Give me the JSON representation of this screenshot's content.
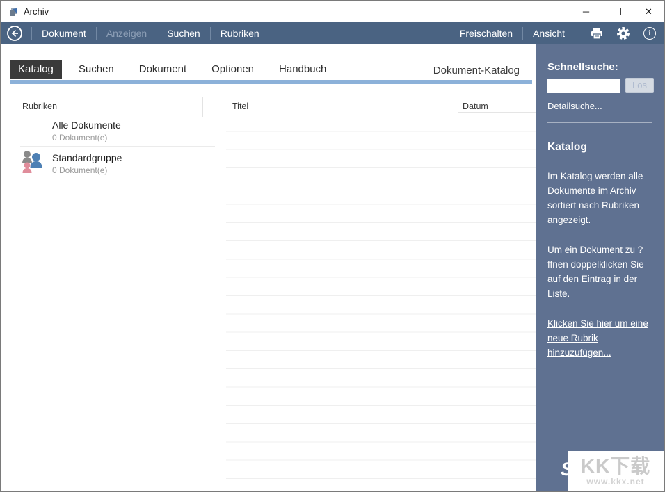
{
  "window": {
    "title": "Archiv",
    "controls": {
      "minimize": "─",
      "maximize": "☐",
      "close": "✕"
    }
  },
  "colors": {
    "toolbar": "#4a6382",
    "sidebar": "#5f7191",
    "accent_bar": "#8cb1d9",
    "active_tab": "#3a3a3a"
  },
  "toolbar": {
    "menu": [
      {
        "label": "Dokument",
        "enabled": true
      },
      {
        "label": "Anzeigen",
        "enabled": false
      },
      {
        "label": "Suchen",
        "enabled": true
      },
      {
        "label": "Rubriken",
        "enabled": true
      }
    ],
    "right": [
      {
        "label": "Freischalten"
      },
      {
        "label": "Ansicht"
      }
    ],
    "icons": [
      "back-icon",
      "printer-icon",
      "gear-icon",
      "info-icon"
    ]
  },
  "tabs": {
    "items": [
      {
        "label": "Katalog",
        "active": true
      },
      {
        "label": "Suchen",
        "active": false
      },
      {
        "label": "Dokument",
        "active": false
      },
      {
        "label": "Optionen",
        "active": false
      },
      {
        "label": "Handbuch",
        "active": false
      }
    ],
    "page_title": "Dokument-Katalog"
  },
  "catalog": {
    "header": "Rubriken",
    "items": [
      {
        "title": "Alle Dokumente",
        "count": "0 Dokument(e)",
        "icon": null
      },
      {
        "title": "Standardgruppe",
        "count": "0 Dokument(e)",
        "icon": "group-icon"
      }
    ]
  },
  "table": {
    "columns": [
      {
        "label": "Titel"
      },
      {
        "label": "Datum"
      }
    ],
    "rows": []
  },
  "sidebar": {
    "quick_search": {
      "label": "Schnellsuche:",
      "input_value": "",
      "button_label": "Los",
      "detail_link": "Detailsuche..."
    },
    "section": {
      "title": "Katalog",
      "p1": "Im Katalog werden alle Dokumente im Archiv sortiert nach Rubriken angezeigt.",
      "p2": "Um ein Dokument zu ?ffnen doppelklicken Sie auf den Eintrag in der Liste.",
      "link": "Klicken Sie hier um eine neue Rubrik hinzuzufügen..."
    },
    "partial_text": "S"
  },
  "watermark": {
    "logo": "KK下载",
    "url": "www.kkx.net"
  }
}
